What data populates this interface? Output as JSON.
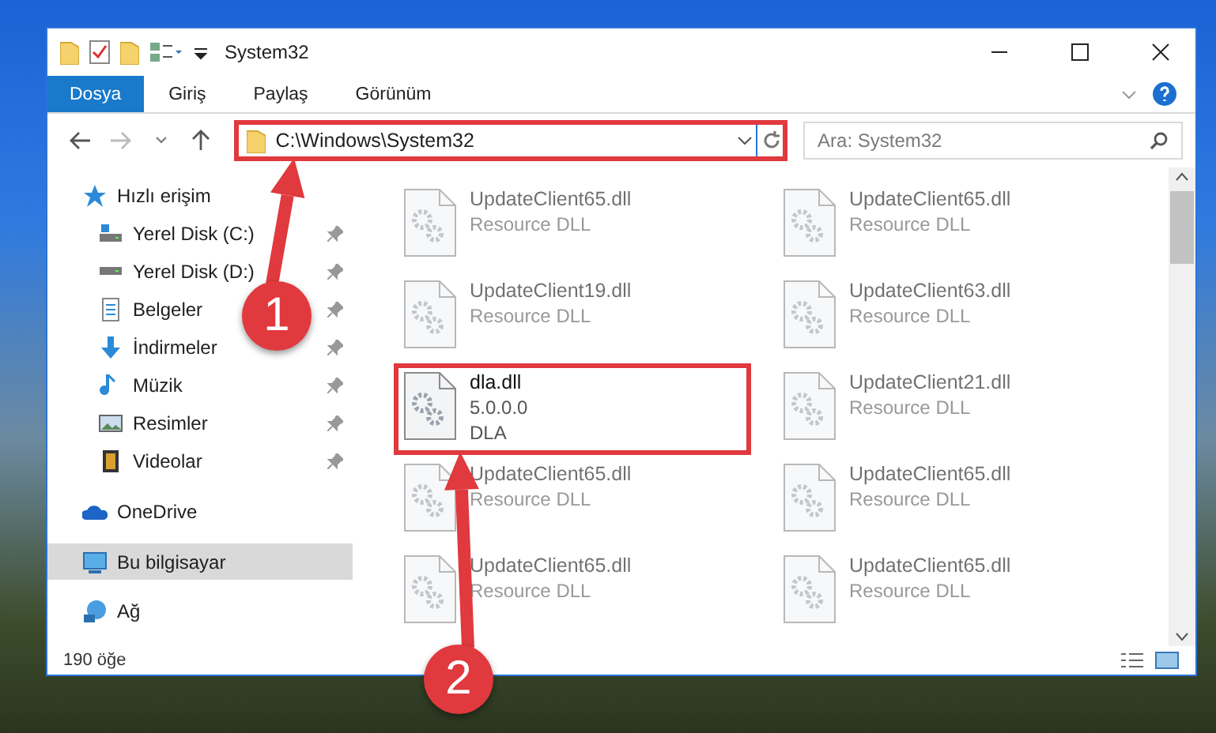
{
  "window": {
    "title": "System32"
  },
  "ribbon_tabs": [
    {
      "label": "Dosya",
      "selected": true
    },
    {
      "label": "Giriş",
      "selected": false
    },
    {
      "label": "Paylaş",
      "selected": false
    },
    {
      "label": "Görünüm",
      "selected": false
    }
  ],
  "address_bar": {
    "path": "C:\\Windows\\System32",
    "highlighted": true
  },
  "search": {
    "placeholder": "Ara: System32"
  },
  "sidebar": {
    "items": [
      {
        "kind": "group",
        "label": "Hızlı erişim",
        "selected": false,
        "children": [
          {
            "kind": "pinned",
            "label": "Yerel Disk (C:)",
            "selected": false
          },
          {
            "kind": "pinned",
            "label": "Yerel Disk (D:)",
            "selected": false
          },
          {
            "kind": "pinned",
            "label": "Belgeler",
            "selected": false
          },
          {
            "kind": "pinned",
            "label": "İndirmeler",
            "selected": false
          },
          {
            "kind": "pinned",
            "label": "Müzik",
            "selected": false
          },
          {
            "kind": "pinned",
            "label": "Resimler",
            "selected": false
          },
          {
            "kind": "pinned",
            "label": "Videolar",
            "selected": false
          }
        ]
      },
      {
        "kind": "group",
        "label": "OneDrive",
        "selected": false
      },
      {
        "kind": "group",
        "label": "Bu bilgisayar",
        "selected": true
      },
      {
        "kind": "group",
        "label": "Ağ",
        "selected": false
      }
    ]
  },
  "files": [
    {
      "name": "UpdateClient65.dll",
      "lines": [
        "Resource DLL"
      ],
      "faded": true,
      "highlighted": false
    },
    {
      "name": "UpdateClient65.dll",
      "lines": [
        "Resource DLL"
      ],
      "faded": true,
      "highlighted": false
    },
    {
      "name": "UpdateClient19.dll",
      "lines": [
        "Resource DLL"
      ],
      "faded": true,
      "highlighted": false
    },
    {
      "name": "UpdateClient63.dll",
      "lines": [
        "Resource DLL"
      ],
      "faded": true,
      "highlighted": false
    },
    {
      "name": "dla.dll",
      "lines": [
        "5.0.0.0",
        "DLA"
      ],
      "faded": false,
      "highlighted": true
    },
    {
      "name": "UpdateClient21.dll",
      "lines": [
        "Resource DLL"
      ],
      "faded": true,
      "highlighted": false
    },
    {
      "name": "UpdateClient65.dll",
      "lines": [
        "Resource DLL"
      ],
      "faded": true,
      "highlighted": false
    },
    {
      "name": "UpdateClient65.dll",
      "lines": [
        "Resource DLL"
      ],
      "faded": true,
      "highlighted": false
    },
    {
      "name": "UpdateClient65.dll",
      "lines": [
        "Resource DLL"
      ],
      "faded": true,
      "highlighted": false
    },
    {
      "name": "UpdateClient65.dll",
      "lines": [
        "Resource DLL"
      ],
      "faded": true,
      "highlighted": false
    }
  ],
  "status_bar": {
    "count": "190 öğe"
  },
  "annotations": [
    {
      "label": "1"
    },
    {
      "label": "2"
    }
  ]
}
